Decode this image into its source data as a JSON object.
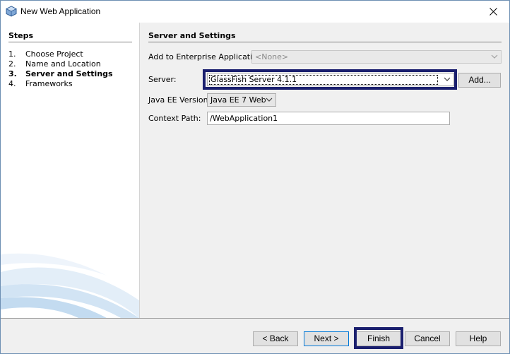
{
  "window": {
    "title": "New Web Application"
  },
  "steps": {
    "title": "Steps",
    "items": [
      {
        "num": "1.",
        "label": "Choose Project"
      },
      {
        "num": "2.",
        "label": "Name and Location"
      },
      {
        "num": "3.",
        "label": "Server and Settings",
        "current": true
      },
      {
        "num": "4.",
        "label": "Frameworks"
      }
    ]
  },
  "section": {
    "title": "Server and Settings"
  },
  "form": {
    "enterprise_label": "Add to Enterprise Application:",
    "enterprise_value": "<None>",
    "server_label": "Server:",
    "server_value": "GlassFish Server 4.1.1",
    "add_label": "Add...",
    "javaee_label": "Java EE Version:",
    "javaee_value": "Java EE 7 Web",
    "context_label": "Context Path:",
    "context_value": "/WebApplication1"
  },
  "buttons": {
    "back": "< Back",
    "next": "Next >",
    "finish": "Finish",
    "cancel": "Cancel",
    "help": "Help"
  },
  "colors": {
    "highlight": "#1a1f6e",
    "panel_bg": "#f0f0f0",
    "window_border": "#6d8fb3"
  }
}
